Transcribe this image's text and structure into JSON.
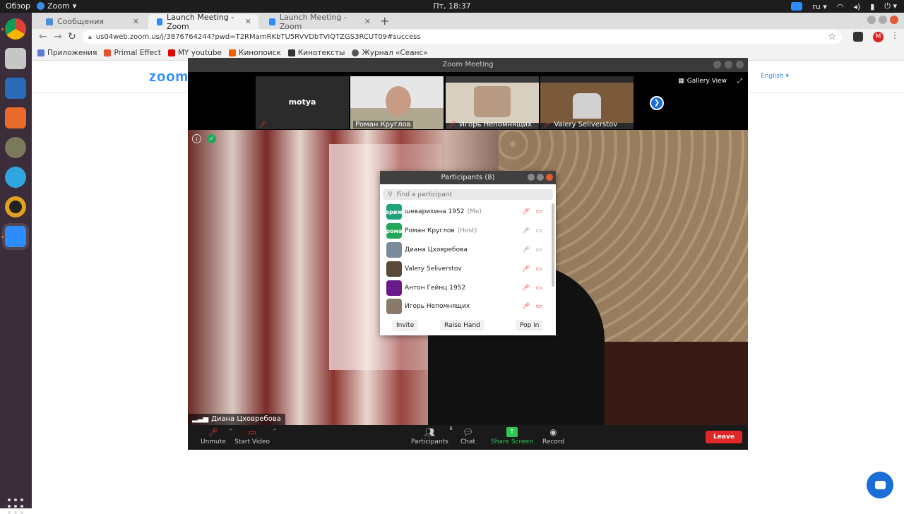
{
  "topbar": {
    "overview": "Обзор",
    "app_name": "Zoom",
    "clock": "Пт, 18:37",
    "lang": "ru"
  },
  "browser": {
    "tabs": [
      {
        "label": "Сообщения"
      },
      {
        "label": "Launch Meeting - Zoom"
      },
      {
        "label": "Launch Meeting - Zoom"
      }
    ],
    "url": "us04web.zoom.us/j/3876764244?pwd=T2RMamRKbTU5RVVDbTVIQTZGS3RCUT09#success",
    "profile_initial": "M",
    "bookmarks": [
      {
        "label": "Приложения",
        "color": "#5b7bd5"
      },
      {
        "label": "Primal Effect",
        "color": "#e2532d"
      },
      {
        "label": "MY youtube",
        "color": "#e00000"
      },
      {
        "label": "Кинопоиск",
        "color": "#f25c05"
      },
      {
        "label": "Кинотексты",
        "color": "#333333"
      },
      {
        "label": "Журнал «Сеанс»",
        "color": "#555555"
      }
    ]
  },
  "page": {
    "logo": "zoom",
    "language": "English"
  },
  "meeting": {
    "window_title": "Zoom Meeting",
    "gallery_view_label": "Gallery View",
    "thumbnails": [
      {
        "name": "",
        "big_name": "motya"
      },
      {
        "name": "Роман Круглов"
      },
      {
        "name": "Игорь Непомнящих"
      },
      {
        "name": "Valery Seliverstov"
      }
    ],
    "active_speaker": "Диана Цховребова",
    "controls": {
      "unmute": "Unmute",
      "start_video": "Start Video",
      "participants": "Participants",
      "participants_count": "8",
      "chat": "Chat",
      "share_screen": "Share Screen",
      "record": "Record",
      "leave": "Leave"
    }
  },
  "participants_panel": {
    "title": "Participants (8)",
    "search_placeholder": "Find a participant",
    "rows": [
      {
        "avatar_text": "ариж",
        "name": "шеварихина 1952",
        "tag": "(Me)",
        "color": "#1fa37a"
      },
      {
        "avatar_text": "рома",
        "name": "Роман Круглов",
        "tag": "(Host)",
        "color": "#23a85a"
      },
      {
        "avatar_text": "",
        "name": "Диана Цховребова",
        "tag": "",
        "color": "#7a8a9a"
      },
      {
        "avatar_text": "",
        "name": "Valery Seliverstov",
        "tag": "",
        "color": "#5a4a3a"
      },
      {
        "avatar_text": "",
        "name": "Антон Гейнц 1952",
        "tag": "",
        "color": "#6a1a8a"
      },
      {
        "avatar_text": "",
        "name": "Игорь Непомнящих",
        "tag": "",
        "color": "#8a7a6a"
      }
    ],
    "invite": "Invite",
    "raise_hand": "Raise Hand",
    "pop_in": "Pop in"
  }
}
